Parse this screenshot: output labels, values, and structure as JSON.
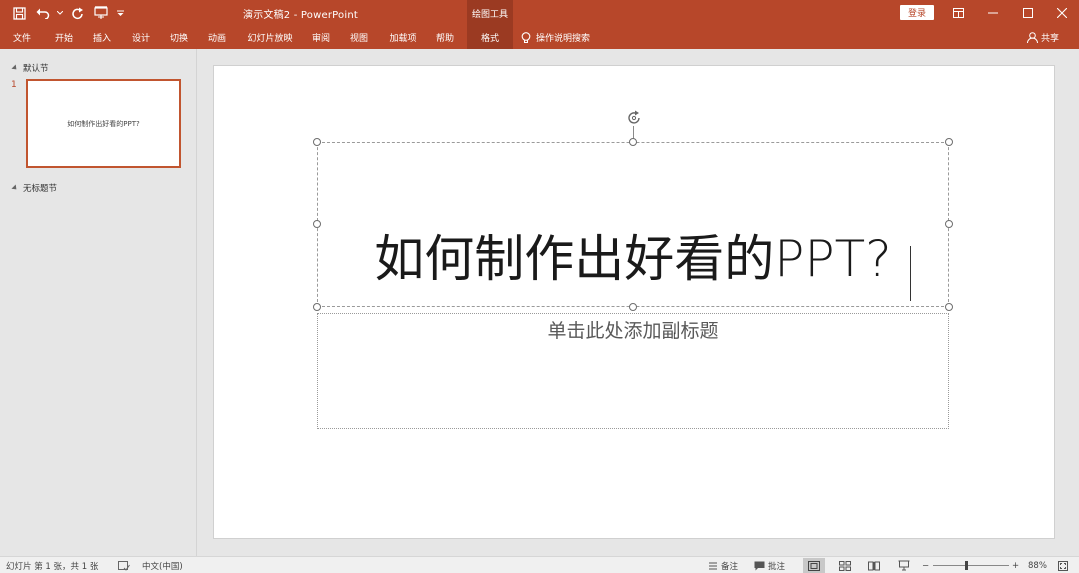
{
  "window": {
    "title": "演示文稿2  -  PowerPoint",
    "context_tab": "绘图工具",
    "login": "登录"
  },
  "ribbon": {
    "tabs": [
      {
        "label": "文件"
      },
      {
        "label": "开始"
      },
      {
        "label": "插入"
      },
      {
        "label": "设计"
      },
      {
        "label": "切换"
      },
      {
        "label": "动画"
      },
      {
        "label": "幻灯片放映"
      },
      {
        "label": "审阅"
      },
      {
        "label": "视图"
      },
      {
        "label": "加载项"
      },
      {
        "label": "帮助"
      },
      {
        "label": "格式"
      }
    ],
    "search": "操作说明搜索",
    "share": "共享"
  },
  "thumbnails": {
    "section1": "默认节",
    "section2": "无标题节",
    "slide_number": "1",
    "slide_title": "如何制作出好看的PPT?"
  },
  "slide": {
    "title": "如何制作出好看的PPT?",
    "subtitle_placeholder": "单击此处添加副标题"
  },
  "status": {
    "slide_info": "幻灯片 第 1 张，共 1 张",
    "language": "中文(中国)",
    "notes": "备注",
    "comments": "批注",
    "zoom": "88%"
  },
  "colors": {
    "accent": "#b7472a"
  }
}
